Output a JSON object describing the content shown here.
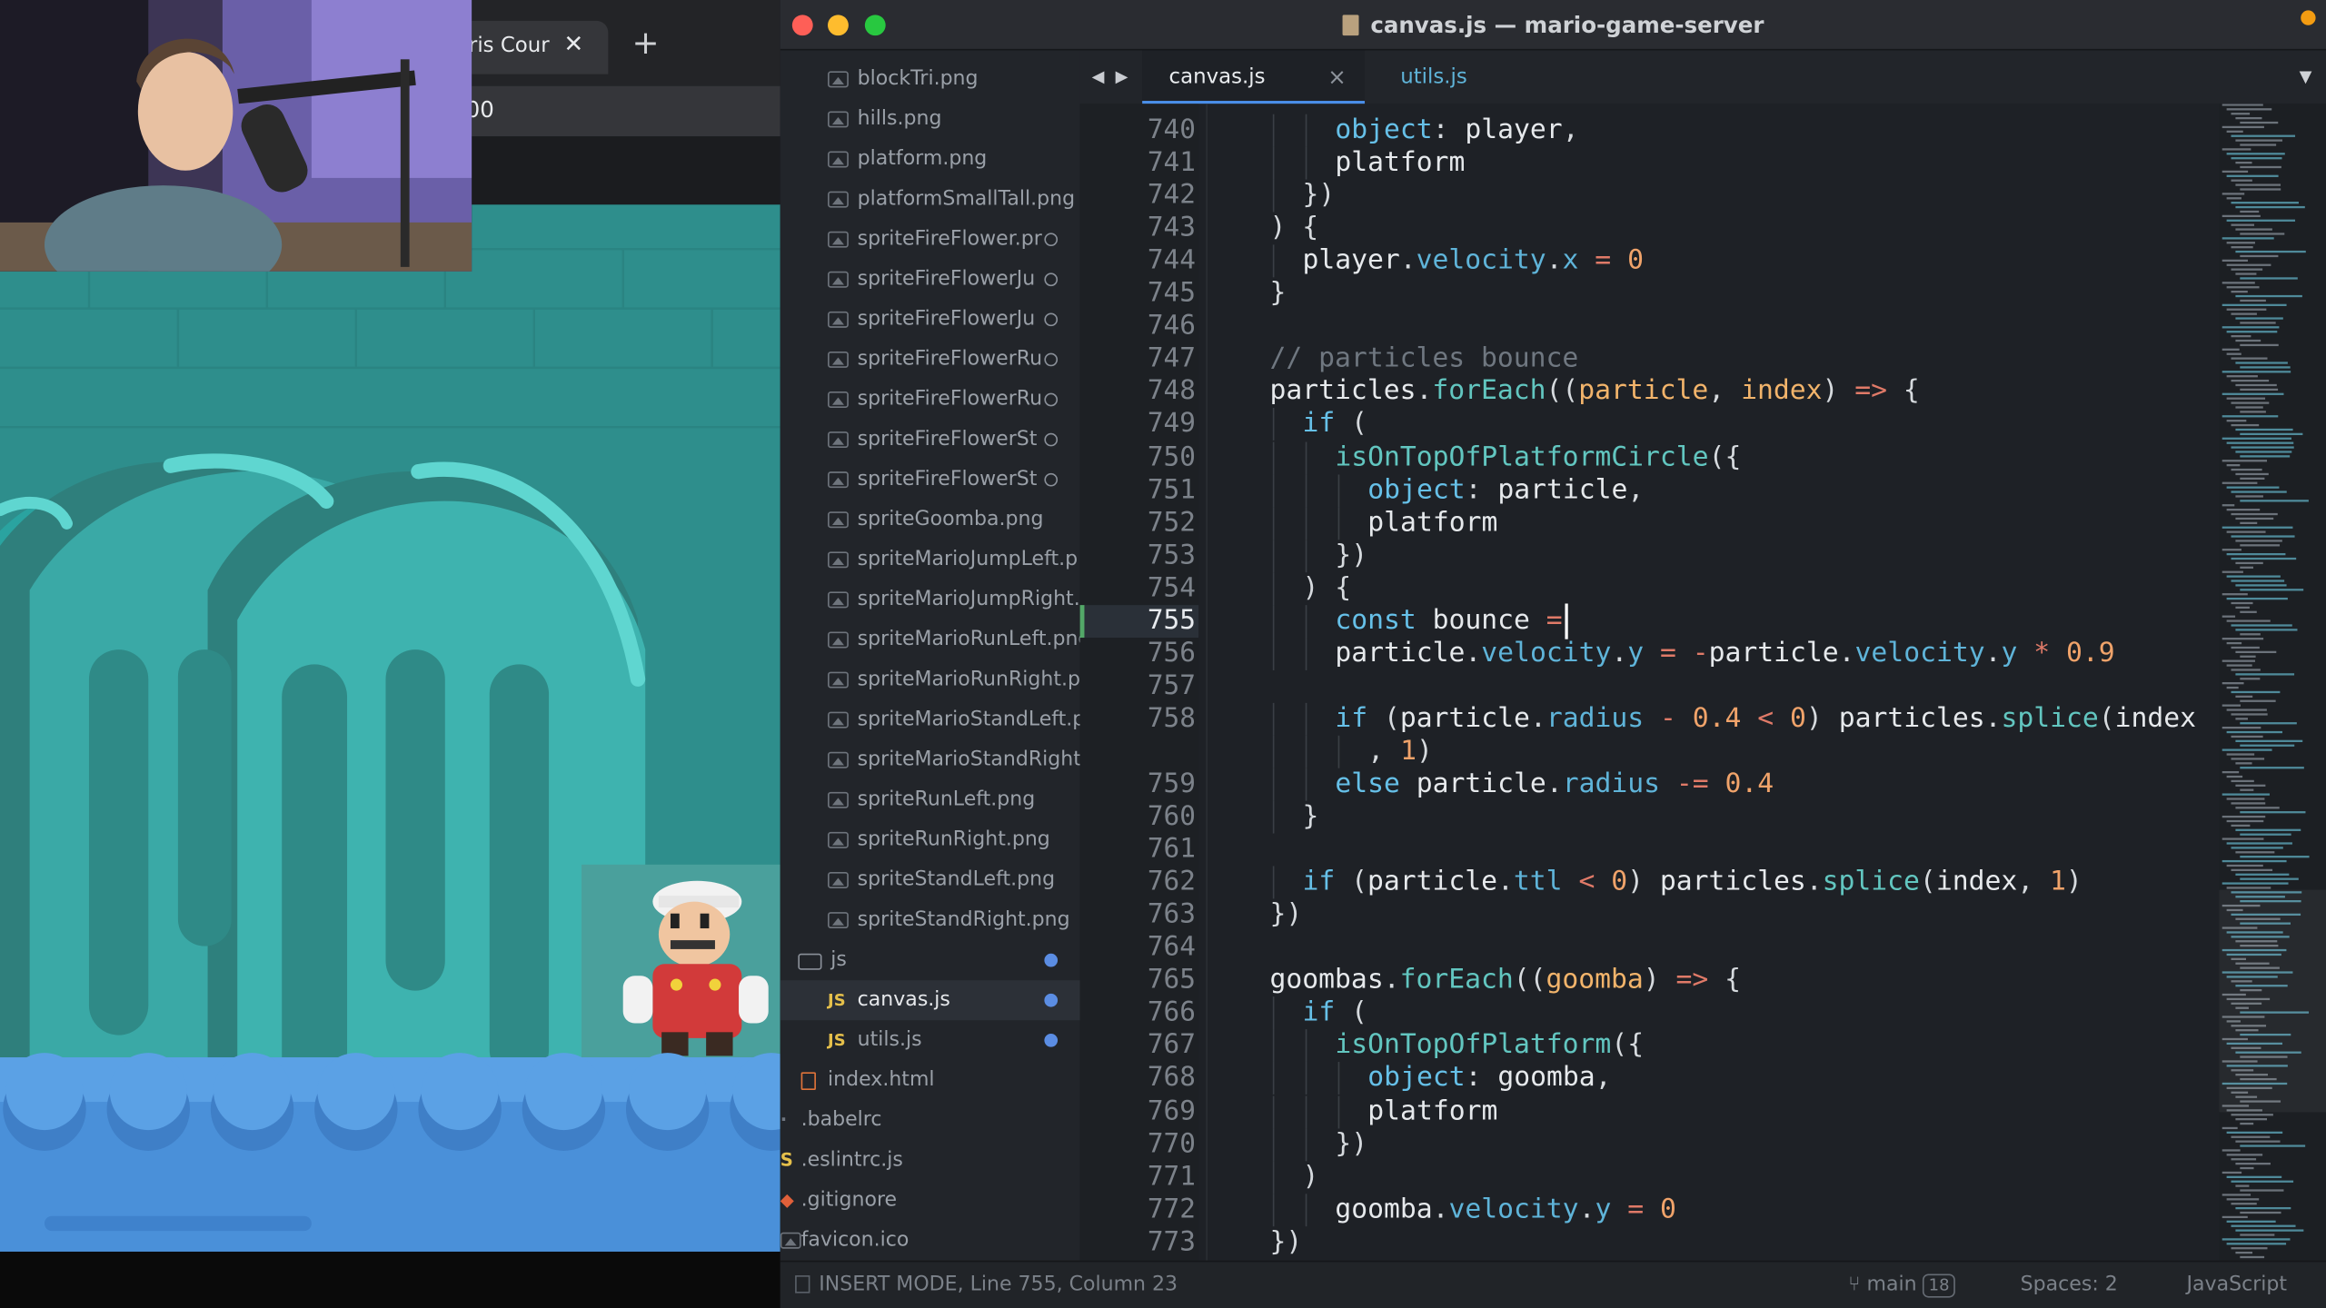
{
  "browser": {
    "tab_title": "ris Cour",
    "tab_close": "✕",
    "new_tab": "+",
    "address_fragment": "00"
  },
  "editor": {
    "window_title": "canvas.js — mario-game-server",
    "tabs": [
      {
        "label": "canvas.js",
        "close": "×",
        "active": true
      },
      {
        "label": "utils.js",
        "active": false
      }
    ],
    "nav_arrows": "◀ ▶",
    "dropdown_glyph": "▼",
    "sidebar_files": [
      {
        "name": "blockTri.png",
        "type": "image",
        "modified": false
      },
      {
        "name": "hills.png",
        "type": "image",
        "modified": false
      },
      {
        "name": "platform.png",
        "type": "image",
        "modified": false
      },
      {
        "name": "platformSmallTall.png",
        "type": "image",
        "modified": false
      },
      {
        "name": "spriteFireFlower.pr",
        "type": "image",
        "modified": true
      },
      {
        "name": "spriteFireFlowerJu",
        "type": "image",
        "modified": true
      },
      {
        "name": "spriteFireFlowerJu",
        "type": "image",
        "modified": true
      },
      {
        "name": "spriteFireFlowerRu",
        "type": "image",
        "modified": true
      },
      {
        "name": "spriteFireFlowerRu",
        "type": "image",
        "modified": true
      },
      {
        "name": "spriteFireFlowerSt",
        "type": "image",
        "modified": true
      },
      {
        "name": "spriteFireFlowerSt",
        "type": "image",
        "modified": true
      },
      {
        "name": "spriteGoomba.png",
        "type": "image",
        "modified": false
      },
      {
        "name": "spriteMarioJumpLeft.p",
        "type": "image",
        "modified": false
      },
      {
        "name": "spriteMarioJumpRight.",
        "type": "image",
        "modified": false
      },
      {
        "name": "spriteMarioRunLeft.png",
        "type": "image",
        "modified": false
      },
      {
        "name": "spriteMarioRunRight.pr",
        "type": "image",
        "modified": false
      },
      {
        "name": "spriteMarioStandLeft.p",
        "type": "image",
        "modified": false
      },
      {
        "name": "spriteMarioStandRight.",
        "type": "image",
        "modified": false
      },
      {
        "name": "spriteRunLeft.png",
        "type": "image",
        "modified": false
      },
      {
        "name": "spriteRunRight.png",
        "type": "image",
        "modified": false
      },
      {
        "name": "spriteStandLeft.png",
        "type": "image",
        "modified": false
      },
      {
        "name": "spriteStandRight.png",
        "type": "image",
        "modified": false
      },
      {
        "name": "js",
        "type": "folder",
        "modified": "filled"
      },
      {
        "name": "canvas.js",
        "type": "js",
        "modified": "filled",
        "active": true
      },
      {
        "name": "utils.js",
        "type": "js",
        "modified": "filled"
      },
      {
        "name": "index.html",
        "type": "html",
        "modified": false
      },
      {
        "name": ".babelrc",
        "type": "config",
        "modified": false
      },
      {
        "name": ".eslintrc.js",
        "type": "configjs",
        "modified": false
      },
      {
        "name": ".gitignore",
        "type": "git",
        "modified": false
      },
      {
        "name": "favicon.ico",
        "type": "image",
        "modified": false
      }
    ],
    "current_line": 755,
    "code_lines": [
      {
        "n": "740",
        "indent": 2,
        "tokens": [
          [
            "k",
            "object"
          ],
          [
            "p",
            ": "
          ],
          [
            "v",
            "player"
          ],
          [
            "p",
            ","
          ]
        ]
      },
      {
        "n": "741",
        "indent": 2,
        "tokens": [
          [
            "v",
            "platform"
          ]
        ]
      },
      {
        "n": "742",
        "indent": 1,
        "tokens": [
          [
            "p",
            "})"
          ]
        ]
      },
      {
        "n": "743",
        "indent": 0,
        "tokens": [
          [
            "p",
            ") {"
          ]
        ]
      },
      {
        "n": "744",
        "indent": 1,
        "tokens": [
          [
            "v",
            "player"
          ],
          [
            "p",
            "."
          ],
          [
            "m",
            "velocity"
          ],
          [
            "p",
            "."
          ],
          [
            "m",
            "x"
          ],
          [
            "o",
            " = "
          ],
          [
            "num",
            "0"
          ]
        ]
      },
      {
        "n": "745",
        "indent": 0,
        "tokens": [
          [
            "p",
            "}"
          ]
        ]
      },
      {
        "n": "746",
        "indent": 0,
        "tokens": []
      },
      {
        "n": "747",
        "indent": 0,
        "tokens": [
          [
            "c",
            "// particles bounce"
          ]
        ]
      },
      {
        "n": "748",
        "indent": 0,
        "tokens": [
          [
            "v",
            "particles"
          ],
          [
            "p",
            "."
          ],
          [
            "f",
            "forEach"
          ],
          [
            "p",
            "(("
          ],
          [
            "param",
            "particle"
          ],
          [
            "p",
            ", "
          ],
          [
            "param",
            "index"
          ],
          [
            "p",
            ") "
          ],
          [
            "o",
            "=>"
          ],
          [
            "p",
            " {"
          ]
        ]
      },
      {
        "n": "749",
        "indent": 1,
        "tokens": [
          [
            "k",
            "if"
          ],
          [
            "p",
            " ("
          ]
        ]
      },
      {
        "n": "750",
        "indent": 2,
        "tokens": [
          [
            "f",
            "isOnTopOfPlatformCircle"
          ],
          [
            "p",
            "({"
          ]
        ]
      },
      {
        "n": "751",
        "indent": 3,
        "tokens": [
          [
            "k",
            "object"
          ],
          [
            "p",
            ": "
          ],
          [
            "v",
            "particle"
          ],
          [
            "p",
            ","
          ]
        ]
      },
      {
        "n": "752",
        "indent": 3,
        "tokens": [
          [
            "v",
            "platform"
          ]
        ]
      },
      {
        "n": "753",
        "indent": 2,
        "tokens": [
          [
            "p",
            "})"
          ]
        ]
      },
      {
        "n": "754",
        "indent": 1,
        "tokens": [
          [
            "p",
            ") {"
          ]
        ]
      },
      {
        "n": "755",
        "indent": 2,
        "tokens": [
          [
            "k",
            "const"
          ],
          [
            "v",
            " bounce "
          ],
          [
            "o",
            "="
          ]
        ]
      },
      {
        "n": "756",
        "indent": 2,
        "tokens": [
          [
            "v",
            "particle"
          ],
          [
            "p",
            "."
          ],
          [
            "m",
            "velocity"
          ],
          [
            "p",
            "."
          ],
          [
            "m",
            "y"
          ],
          [
            "o",
            " = -"
          ],
          [
            "v",
            "particle"
          ],
          [
            "p",
            "."
          ],
          [
            "m",
            "velocity"
          ],
          [
            "p",
            "."
          ],
          [
            "m",
            "y"
          ],
          [
            "o",
            " * "
          ],
          [
            "num",
            "0.9"
          ]
        ]
      },
      {
        "n": "757",
        "indent": 0,
        "tokens": []
      },
      {
        "n": "758",
        "indent": 2,
        "tokens": [
          [
            "k",
            "if"
          ],
          [
            "p",
            " ("
          ],
          [
            "v",
            "particle"
          ],
          [
            "p",
            "."
          ],
          [
            "m",
            "radius"
          ],
          [
            "o",
            " - "
          ],
          [
            "num",
            "0.4"
          ],
          [
            "o",
            " < "
          ],
          [
            "num",
            "0"
          ],
          [
            "p",
            ") "
          ],
          [
            "v",
            "particles"
          ],
          [
            "p",
            "."
          ],
          [
            "f",
            "splice"
          ],
          [
            "p",
            "("
          ],
          [
            "v",
            "index"
          ]
        ]
      },
      {
        "n": "",
        "indent": 3,
        "tokens": [
          [
            "p",
            ", "
          ],
          [
            "num",
            "1"
          ],
          [
            "p",
            ")"
          ]
        ]
      },
      {
        "n": "759",
        "indent": 2,
        "tokens": [
          [
            "k",
            "else"
          ],
          [
            "v",
            " particle"
          ],
          [
            "p",
            "."
          ],
          [
            "m",
            "radius"
          ],
          [
            "o",
            " -= "
          ],
          [
            "num",
            "0.4"
          ]
        ]
      },
      {
        "n": "760",
        "indent": 1,
        "tokens": [
          [
            "p",
            "}"
          ]
        ]
      },
      {
        "n": "761",
        "indent": 0,
        "tokens": []
      },
      {
        "n": "762",
        "indent": 1,
        "tokens": [
          [
            "k",
            "if"
          ],
          [
            "p",
            " ("
          ],
          [
            "v",
            "particle"
          ],
          [
            "p",
            "."
          ],
          [
            "m",
            "ttl"
          ],
          [
            "o",
            " < "
          ],
          [
            "num",
            "0"
          ],
          [
            "p",
            ") "
          ],
          [
            "v",
            "particles"
          ],
          [
            "p",
            "."
          ],
          [
            "f",
            "splice"
          ],
          [
            "p",
            "("
          ],
          [
            "v",
            "index"
          ],
          [
            "p",
            ", "
          ],
          [
            "num",
            "1"
          ],
          [
            "p",
            ")"
          ]
        ]
      },
      {
        "n": "763",
        "indent": 0,
        "tokens": [
          [
            "p",
            "})"
          ]
        ]
      },
      {
        "n": "764",
        "indent": 0,
        "tokens": []
      },
      {
        "n": "765",
        "indent": 0,
        "tokens": [
          [
            "v",
            "goombas"
          ],
          [
            "p",
            "."
          ],
          [
            "f",
            "forEach"
          ],
          [
            "p",
            "(("
          ],
          [
            "param",
            "goomba"
          ],
          [
            "p",
            ") "
          ],
          [
            "o",
            "=>"
          ],
          [
            "p",
            " {"
          ]
        ]
      },
      {
        "n": "766",
        "indent": 1,
        "tokens": [
          [
            "k",
            "if"
          ],
          [
            "p",
            " ("
          ]
        ]
      },
      {
        "n": "767",
        "indent": 2,
        "tokens": [
          [
            "f",
            "isOnTopOfPlatform"
          ],
          [
            "p",
            "({"
          ]
        ]
      },
      {
        "n": "768",
        "indent": 3,
        "tokens": [
          [
            "k",
            "object"
          ],
          [
            "p",
            ": "
          ],
          [
            "v",
            "goomba"
          ],
          [
            "p",
            ","
          ]
        ]
      },
      {
        "n": "769",
        "indent": 3,
        "tokens": [
          [
            "v",
            "platform"
          ]
        ]
      },
      {
        "n": "770",
        "indent": 2,
        "tokens": [
          [
            "p",
            "})"
          ]
        ]
      },
      {
        "n": "771",
        "indent": 1,
        "tokens": [
          [
            "p",
            ")"
          ]
        ]
      },
      {
        "n": "772",
        "indent": 2,
        "tokens": [
          [
            "v",
            "goomba"
          ],
          [
            "p",
            "."
          ],
          [
            "m",
            "velocity"
          ],
          [
            "p",
            "."
          ],
          [
            "m",
            "y"
          ],
          [
            "o",
            " = "
          ],
          [
            "num",
            "0"
          ]
        ]
      },
      {
        "n": "773",
        "indent": 0,
        "tokens": [
          [
            "p",
            "})"
          ]
        ]
      }
    ],
    "token_colors": {
      "k": "#66c0e8",
      "p": "#d6dade",
      "v": "#e6e9ec",
      "m": "#5fb4d9",
      "f": "#62c6c0",
      "o": "#e07a68",
      "num": "#f0a36a",
      "c": "#6f7780",
      "param": "#f2b46b"
    },
    "status": {
      "mode": "INSERT MODE, Line 755, Column 23",
      "branch": "main",
      "branch_count": "18",
      "spaces": "Spaces: 2",
      "language": "JavaScript"
    }
  },
  "colors": {
    "editor_bg": "#1e2126",
    "sidebar_bg": "#22252a",
    "accent": "#4a8ee8",
    "modified_dot": "#5b8de3"
  }
}
